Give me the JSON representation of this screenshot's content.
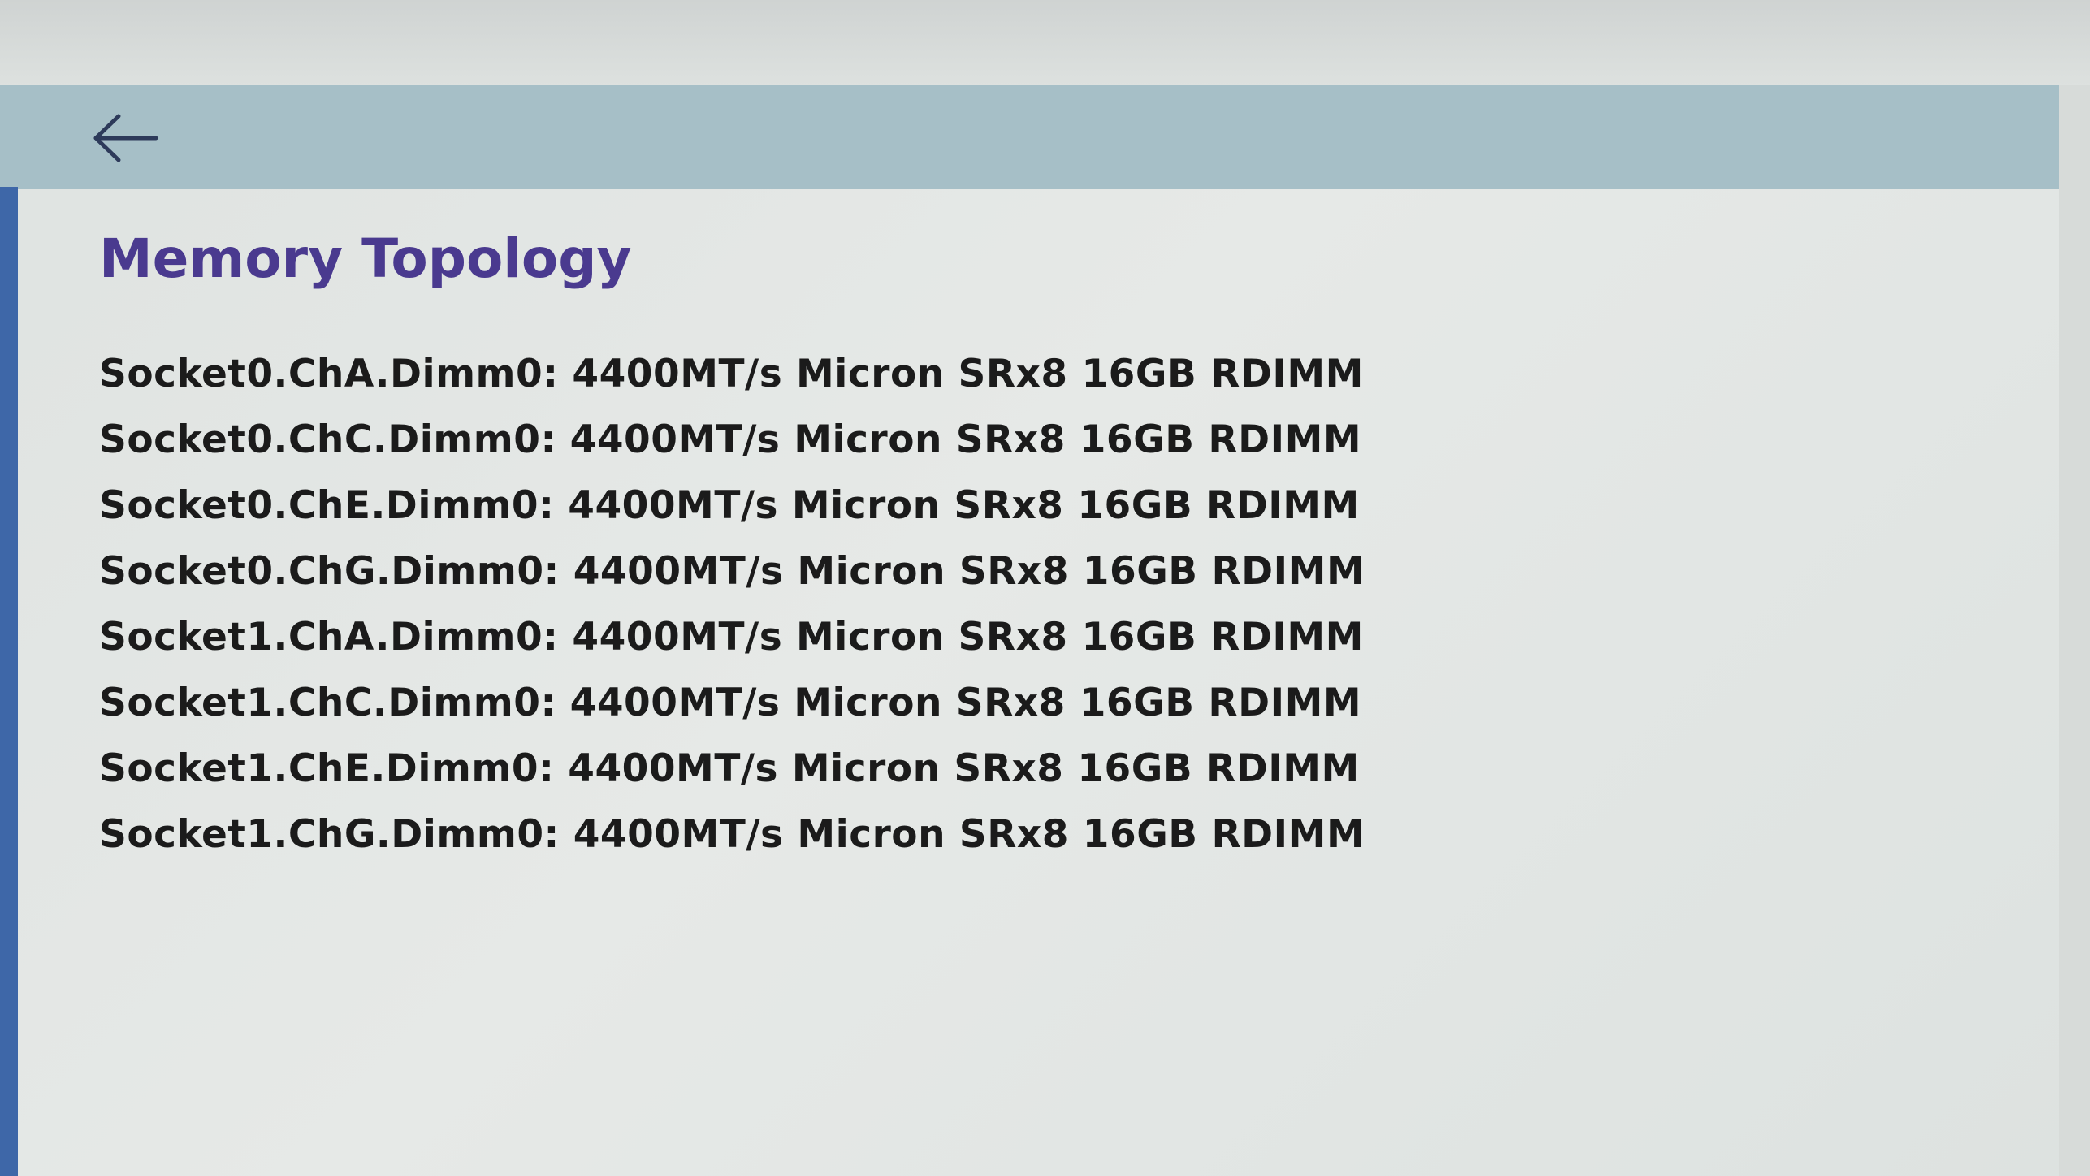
{
  "header": {
    "back_icon": "arrow-left-icon",
    "accent_color": "#a6bfc7"
  },
  "page": {
    "title": "Memory Topology",
    "title_color": "#4a3a8f"
  },
  "dimms": [
    {
      "label": "Socket0.ChA.Dimm0: 4400MT/s Micron SRx8 16GB RDIMM"
    },
    {
      "label": "Socket0.ChC.Dimm0: 4400MT/s Micron SRx8 16GB RDIMM"
    },
    {
      "label": "Socket0.ChE.Dimm0: 4400MT/s Micron SRx8 16GB RDIMM"
    },
    {
      "label": "Socket0.ChG.Dimm0: 4400MT/s Micron SRx8 16GB RDIMM"
    },
    {
      "label": "Socket1.ChA.Dimm0: 4400MT/s Micron SRx8 16GB RDIMM"
    },
    {
      "label": "Socket1.ChC.Dimm0: 4400MT/s Micron SRx8 16GB RDIMM"
    },
    {
      "label": "Socket1.ChE.Dimm0: 4400MT/s Micron SRx8 16GB RDIMM"
    },
    {
      "label": "Socket1.ChG.Dimm0: 4400MT/s Micron SRx8 16GB RDIMM"
    }
  ]
}
